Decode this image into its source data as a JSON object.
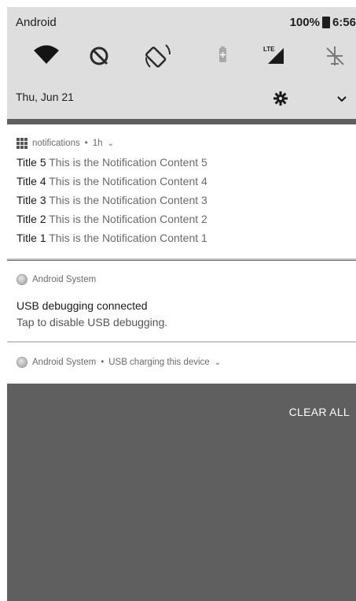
{
  "status_bar": {
    "title": "Android",
    "battery": "100%",
    "time": "6:56"
  },
  "quick_settings": {
    "tiles": [
      "wifi-icon",
      "do-not-disturb-off-icon",
      "auto-rotate-icon",
      "battery-saver-icon",
      "lte-signal-icon",
      "airplane-mode-icon"
    ],
    "date": "Thu, Jun 21"
  },
  "notification_group": {
    "app_name": "notifications",
    "time_ago": "1h",
    "items": [
      {
        "title": "Title 5",
        "content": "This is the Notification Content 5"
      },
      {
        "title": "Title 4",
        "content": "This is the Notification Content 4"
      },
      {
        "title": "Title 3",
        "content": "This is the Notification Content 3"
      },
      {
        "title": "Title 2",
        "content": "This is the Notification Content 2"
      },
      {
        "title": "Title 1",
        "content": "This is the Notification Content 1"
      }
    ]
  },
  "usb_debugging": {
    "app_name": "Android System",
    "title": "USB debugging connected",
    "text": "Tap to disable USB debugging."
  },
  "usb_charging": {
    "app_name": "Android System",
    "text": "USB charging this device"
  },
  "actions": {
    "clear_all": "CLEAR ALL"
  },
  "colors": {
    "shade_background": "#dedede",
    "scrim": "#5f5f5f",
    "card": "#ffffff"
  }
}
